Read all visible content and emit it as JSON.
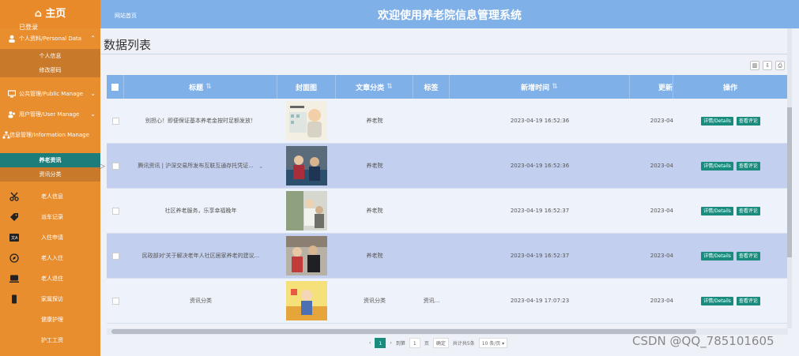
{
  "sidebar": {
    "home": "⌂ 主页",
    "tooltip": "已登录",
    "personal_group": "个人资料/Personal Data",
    "personal_items": [
      "个人信息",
      "修改密码"
    ],
    "public_group": "公共管理/Public Manage",
    "user_group": "用户管理/User Manage",
    "info_group": "信息管理/Information Manage",
    "info_items": [
      "养老资讯",
      "资讯分类"
    ],
    "other_items": [
      "老人信息",
      "派车记录",
      "入住申请",
      "老人入住",
      "老人退住",
      "家属探访",
      "健康护理",
      "护工工资"
    ]
  },
  "header": {
    "home_link": "网站首页",
    "system_title": "欢迎使用养老院信息管理系统"
  },
  "main": {
    "title": "数据列表",
    "columns": [
      "标题",
      "封面图",
      "文章分类",
      "标签",
      "新增时间",
      "更新",
      "操作"
    ],
    "rows": [
      {
        "title": "别担心！即便保证基本养老金按时足额发放！",
        "category": "养老院",
        "tag": "",
        "time": "2023-04-19 16:52:36",
        "updated": "2023-04"
      },
      {
        "title": "腾讯资讯 | 沪深交易所发布互联互通存托凭证...",
        "category": "养老院",
        "tag": "",
        "time": "2023-04-19 16:52:36",
        "updated": "2023-04"
      },
      {
        "title": "社区养老服务，乐享幸福晚年",
        "category": "养老院",
        "tag": "",
        "time": "2023-04-19 16:52:37",
        "updated": "2023-04"
      },
      {
        "title": "民政部对'关于解决老年人社区居家养老的建议...",
        "category": "养老院",
        "tag": "",
        "time": "2023-04-19 16:52:37",
        "updated": "2023-04"
      },
      {
        "title": "资讯分类",
        "category": "资讯分类",
        "tag": "资讯...",
        "time": "2023-04-19 17:07:23",
        "updated": "2023-04"
      }
    ],
    "btn_detail": "详情/Details",
    "btn_comment": "查看评论"
  },
  "pager": {
    "current": "1",
    "goto_label": "到第",
    "page_input": "1",
    "page_unit": "页",
    "confirm": "确定",
    "total": "共计共5条",
    "size": "10 条/页 ▾"
  },
  "watermark": "CSDN @QQ_785101605",
  "colors": {
    "sidebar": "#e88e2f",
    "header": "#7fb0e8",
    "button": "#1a8c7e",
    "active": "#1d7d7a"
  }
}
